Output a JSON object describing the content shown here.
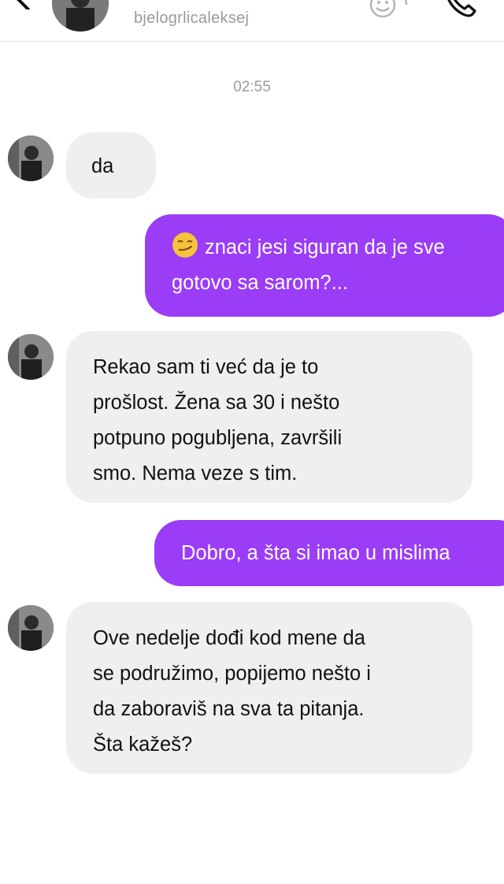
{
  "header": {
    "username": "bjelogrlicaleksej",
    "icons": [
      "back-arrow-icon",
      "profile-avatar",
      "sticker-icon",
      "phone-call-icon"
    ]
  },
  "chat": {
    "timestamp": "02:55",
    "colors": {
      "incoming_bubble": "#efefef",
      "outgoing_bubble": "#9b3cf6",
      "outgoing_text": "#ffffff"
    },
    "messages": [
      {
        "sender": "other",
        "lines": [
          "da"
        ]
      },
      {
        "sender": "me",
        "emoji": "smirking-face-icon",
        "lines": [
          "znaci jesi siguran da je sve",
          "gotovo sa sarom?..."
        ]
      },
      {
        "sender": "other",
        "lines": [
          "Rekao sam ti već da je to",
          "prošlost. Žena sa 30 i nešto",
          "potpuno pogubljena, završili",
          "smo. Nema veze s tim."
        ]
      },
      {
        "sender": "me",
        "lines": [
          "Dobro, a šta si imao u mislima"
        ]
      },
      {
        "sender": "other",
        "lines": [
          "Ove nedelje dođi kod mene da",
          "se podružimo, popijemo nešto i",
          "da zaboraviš na sva ta pitanja.",
          "Šta kažeš?"
        ]
      }
    ]
  }
}
